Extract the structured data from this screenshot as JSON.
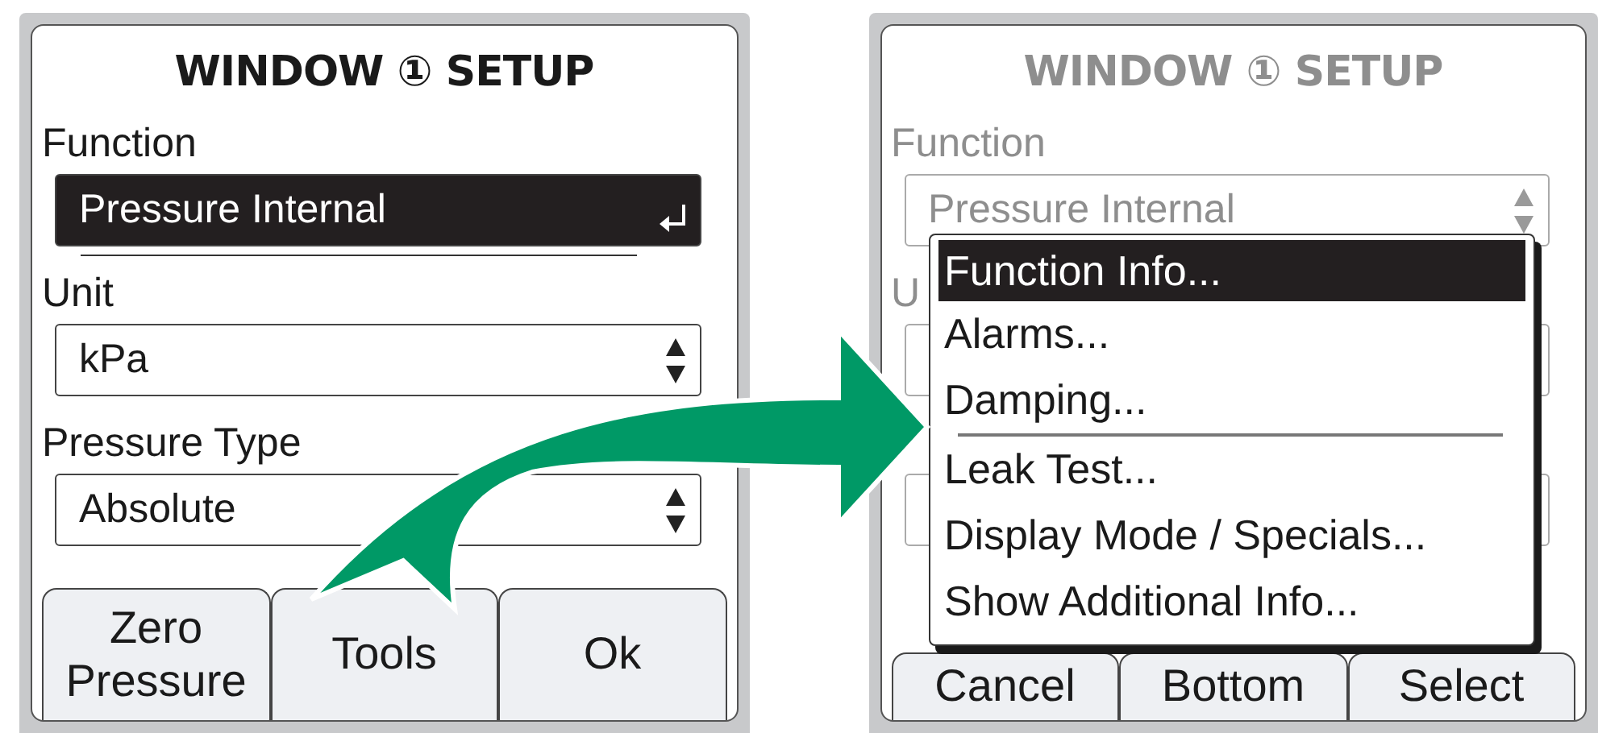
{
  "screens": [
    {
      "title": "WINDOW ① SETUP",
      "dimmed": false,
      "fields": [
        {
          "label": "Function",
          "value": "Pressure Internal",
          "selected": true,
          "kind": "enter"
        },
        {
          "label": "Unit",
          "value": "kPa",
          "selected": false,
          "kind": "spinner"
        },
        {
          "label": "Pressure Type",
          "value": "Absolute",
          "selected": false,
          "kind": "spinner"
        }
      ],
      "softkeys": [
        "Zero Pressure",
        "Tools",
        "Ok"
      ]
    },
    {
      "title": "WINDOW ① SETUP",
      "dimmed": true,
      "fields": [
        {
          "label": "Function",
          "value": "Pressure Internal",
          "selected": false,
          "kind": "spinner"
        },
        {
          "label": "U",
          "selected": false,
          "kind": "plain"
        },
        {
          "selected": false,
          "kind": "plain"
        }
      ],
      "menu": {
        "items": [
          {
            "label": "Function Info...",
            "selected": true,
            "separator_after": false
          },
          {
            "label": "Alarms...",
            "selected": false,
            "separator_after": false
          },
          {
            "label": "Damping...",
            "selected": false,
            "separator_after": true
          },
          {
            "label": "Leak Test...",
            "selected": false,
            "separator_after": false
          },
          {
            "label": "Display Mode / Specials...",
            "selected": false,
            "separator_after": false
          },
          {
            "label": "Show Additional Info...",
            "selected": false,
            "separator_after": false
          }
        ]
      },
      "softkeys": [
        "Cancel",
        "Bottom",
        "Select"
      ]
    }
  ]
}
